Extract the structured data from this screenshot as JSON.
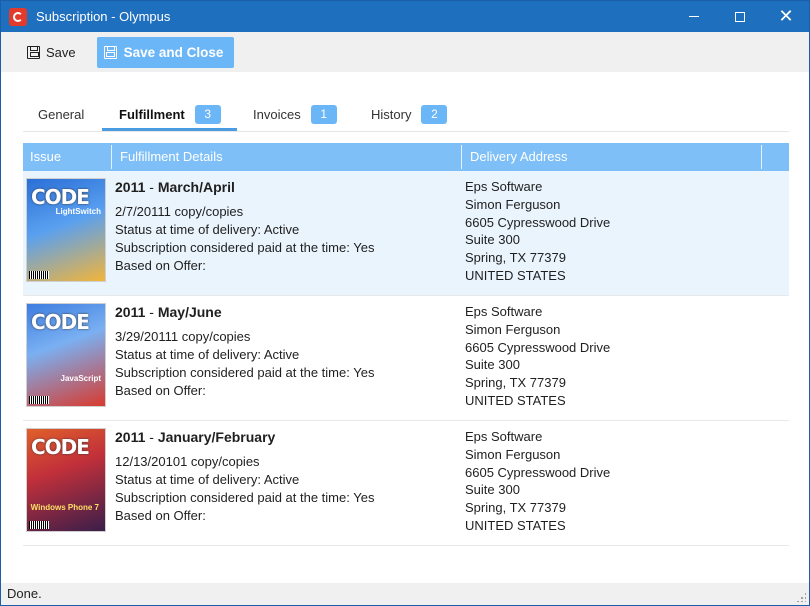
{
  "window": {
    "title": "Subscription - Olympus",
    "titlebar_color": "#1f6fbf",
    "app_icon": "olympus-logo-icon"
  },
  "toolbar": {
    "save_label": "Save",
    "save_close_label": "Save and Close",
    "save_close_color": "#6bb6f7"
  },
  "tabs": [
    {
      "label": "General",
      "badge": null,
      "active": false
    },
    {
      "label": "Fulfillment",
      "badge": "3",
      "active": true
    },
    {
      "label": "Invoices",
      "badge": "1",
      "active": false
    },
    {
      "label": "History",
      "badge": "2",
      "active": false
    }
  ],
  "grid": {
    "columns": [
      "Issue",
      "Fulfillment Details",
      "Delivery Address"
    ],
    "header_color": "#7fbff8",
    "rows": [
      {
        "cover_title": "CODE",
        "cover_sub": "LightSwitch",
        "cover_colors": [
          "#2a6fd6",
          "#f2b53a"
        ],
        "year": "2011",
        "sep": "-",
        "issue": "March/April",
        "date_copies": "2/7/20111 copy/copies",
        "status": "Status at time of delivery: Active",
        "paid": "Subscription considered paid at the time: Yes",
        "offer": "Based on Offer:",
        "address": [
          "Eps Software",
          "Simon Ferguson",
          "6605 Cypresswood Drive",
          "Suite 300",
          "Spring, TX 77379",
          "UNITED STATES"
        ]
      },
      {
        "cover_title": "CODE",
        "cover_sub": "JavaScript",
        "cover_colors": [
          "#3d7de0",
          "#d83a2e"
        ],
        "year": "2011",
        "sep": "-",
        "issue": "May/June",
        "date_copies": "3/29/20111 copy/copies",
        "status": "Status at time of delivery: Active",
        "paid": "Subscription considered paid at the time: Yes",
        "offer": "Based on Offer:",
        "address": [
          "Eps Software",
          "Simon Ferguson",
          "6605 Cypresswood Drive",
          "Suite 300",
          "Spring, TX 77379",
          "UNITED STATES"
        ]
      },
      {
        "cover_title": "CODE",
        "cover_sub": "Windows Phone 7",
        "cover_colors": [
          "#e0602a",
          "#3a1e4a"
        ],
        "year": "2011",
        "sep": "-",
        "issue": "January/February",
        "date_copies": "12/13/20101 copy/copies",
        "status": "Status at time of delivery: Active",
        "paid": "Subscription considered paid at the time: Yes",
        "offer": "Based on Offer:",
        "address": [
          "Eps Software",
          "Simon Ferguson",
          "6605 Cypresswood Drive",
          "Suite 300",
          "Spring, TX 77379",
          "UNITED STATES"
        ]
      }
    ]
  },
  "statusbar": {
    "text": "Done."
  }
}
